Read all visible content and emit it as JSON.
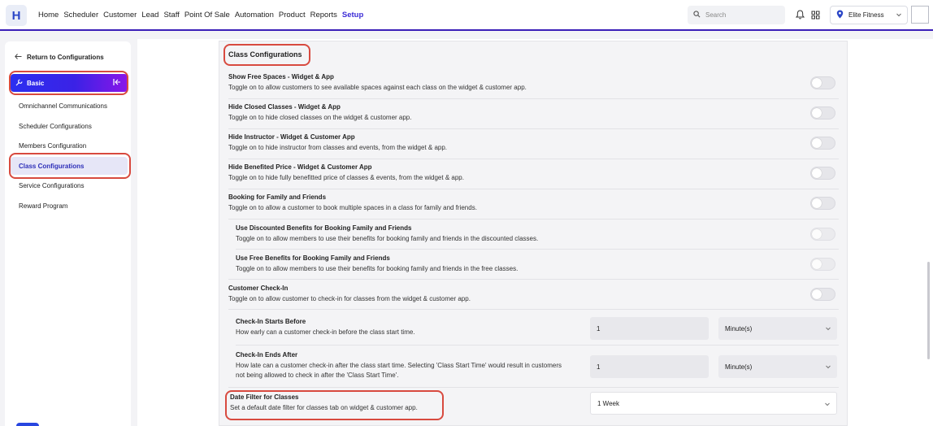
{
  "app": {
    "logo_letter": "H"
  },
  "nav": {
    "items": [
      "Home",
      "Scheduler",
      "Customer",
      "Lead",
      "Staff",
      "Point Of Sale",
      "Automation",
      "Product",
      "Reports",
      "Setup"
    ],
    "active": "Setup"
  },
  "search": {
    "placeholder": "Search"
  },
  "location": {
    "name": "Elite Fitness"
  },
  "sidebar": {
    "back_label": "Return to Configurations",
    "group_label": "Basic",
    "items": [
      "Omnichannel Communications",
      "Scheduler Configurations",
      "Members Configuration",
      "Class Configurations",
      "Service Configurations",
      "Reward Program"
    ],
    "active_item": "Class Configurations"
  },
  "main": {
    "section_title": "Class Configurations",
    "settings": [
      {
        "title": "Show Free Spaces - Widget & App",
        "desc": "Toggle on to allow customers to see available spaces against each class on the widget & customer app.",
        "enabled": false
      },
      {
        "title": "Hide Closed Classes - Widget & App",
        "desc": "Toggle on to hide closed classes on the widget & customer app.",
        "enabled": false
      },
      {
        "title": "Hide Instructor - Widget & Customer App",
        "desc": "Toggle on to hide instructor from classes and events, from the widget & app.",
        "enabled": false
      },
      {
        "title": "Hide Benefited Price - Widget & Customer App",
        "desc": "Toggle on to hide fully benefitted price of classes & events, from the widget & app.",
        "enabled": false
      },
      {
        "title": "Booking for Family and Friends",
        "desc": "Toggle on to allow a customer to book multiple spaces in a class for family and friends.",
        "enabled": false
      },
      {
        "title": "Use Discounted Benefits for Booking Family and Friends",
        "desc": "Toggle on to allow members to use their benefits for booking family and friends in the discounted classes.",
        "enabled": false,
        "disabled": true
      },
      {
        "title": "Use Free Benefits for Booking Family and Friends",
        "desc": "Toggle on to allow members to use their benefits for booking family and friends in the free classes.",
        "enabled": false,
        "disabled": true
      },
      {
        "title": "Customer Check-In",
        "desc": "Toggle on to allow customer to check-in for classes from the widget & customer app.",
        "enabled": false
      }
    ],
    "checkin_start": {
      "title": "Check-In Starts Before",
      "desc": "How early can a customer check-in before the class start time.",
      "value": "1",
      "unit": "Minute(s)"
    },
    "checkin_end": {
      "title": "Check-In Ends After",
      "desc_line1": "How late can a customer check-in after the class start time. Selecting 'Class Start Time' would result in customers",
      "desc_line2": "not being allowed to check in after the 'Class Start Time'.",
      "value": "1",
      "unit": "Minute(s)"
    },
    "date_filter": {
      "title": "Date Filter for Classes",
      "desc": "Set a default date filter for classes tab on widget & customer app.",
      "value": "1 Week"
    }
  },
  "colors": {
    "accent": "#3b2bd6",
    "highlight": "#d84a3f",
    "gradient_start": "#2b2ff0",
    "gradient_end": "#8a16e8"
  }
}
